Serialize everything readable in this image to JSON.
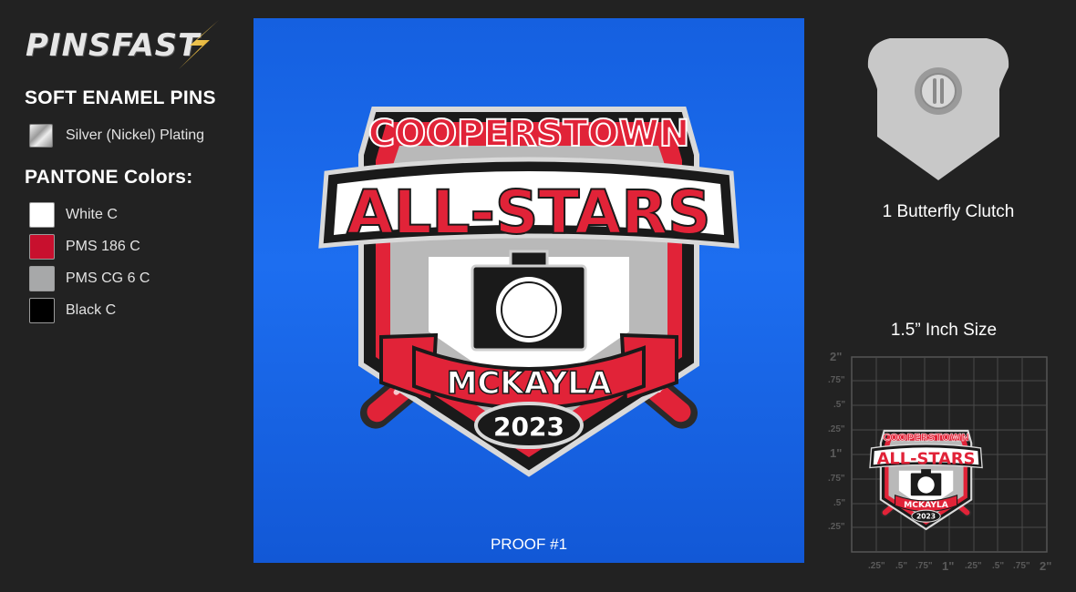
{
  "brand": {
    "logo_text": "PINSFAST"
  },
  "left": {
    "heading": "SOFT ENAMEL PINS",
    "plating": {
      "label": "Silver (Nickel) Plating",
      "color": "#cfcfcf"
    },
    "colors_heading": "PANTONE Colors:",
    "colors": [
      {
        "label": "White C",
        "hex": "#ffffff"
      },
      {
        "label": "PMS 186 C",
        "hex": "#c8102e"
      },
      {
        "label": "PMS CG 6 C",
        "hex": "#a7a8a9"
      },
      {
        "label": "Black C",
        "hex": "#000000"
      }
    ]
  },
  "proof": {
    "label": "PROOF #1",
    "background": "#1a66e8",
    "pin": {
      "line1": "COOPERSTOWN",
      "line2": "ALL-STARS",
      "name": "MCKAYLA",
      "year": "2023"
    }
  },
  "back": {
    "label": "1 Butterfly Clutch"
  },
  "size": {
    "title": "1.5” Inch Size",
    "y_ticks": [
      "2\"",
      ".75\"",
      ".5\"",
      ".25\"",
      "1\"",
      ".75\"",
      ".5\"",
      ".25\""
    ],
    "x_ticks": [
      ".25\"",
      ".5\"",
      ".75\"",
      "1\"",
      ".25\"",
      ".5\"",
      ".75\"",
      "2\""
    ]
  }
}
